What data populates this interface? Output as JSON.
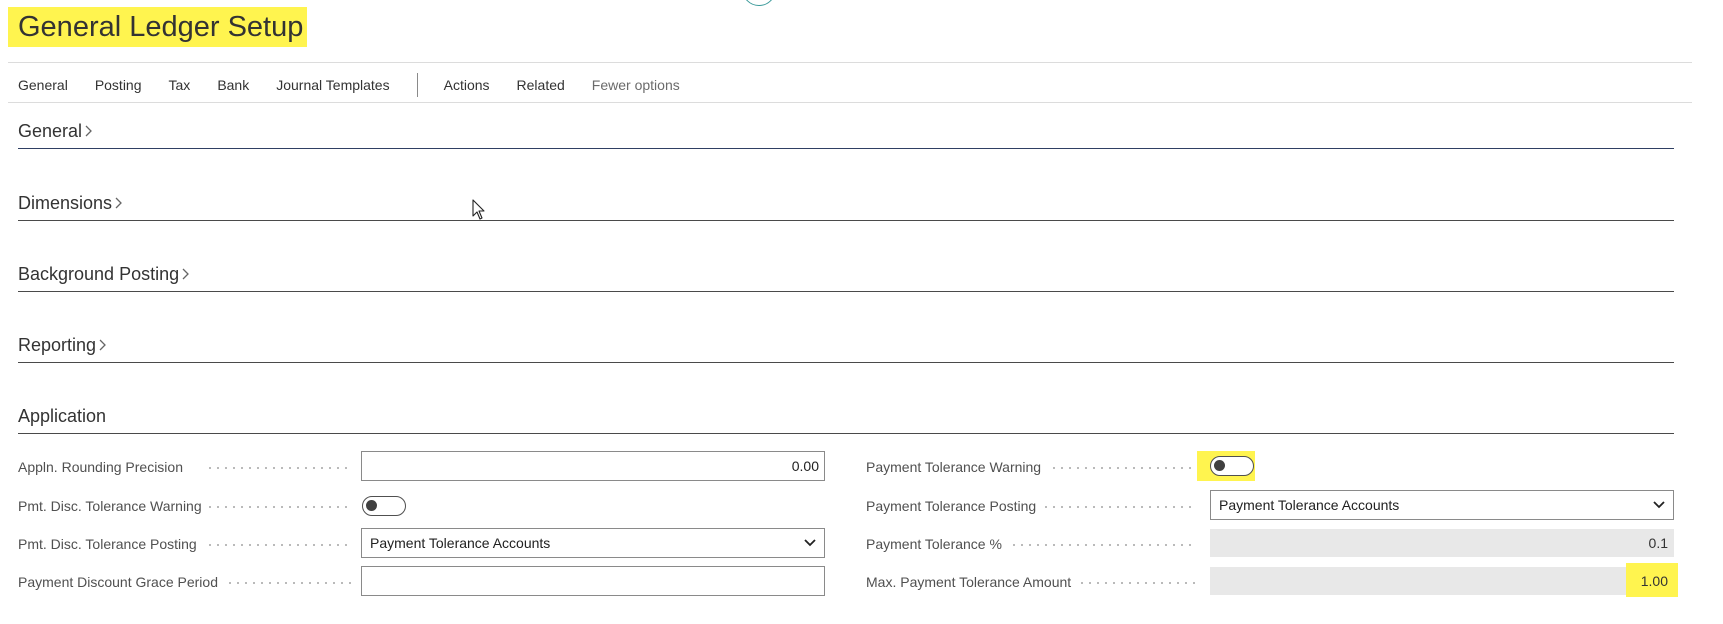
{
  "page": {
    "title": "General Ledger Setup"
  },
  "actionbar": {
    "items": [
      "General",
      "Posting",
      "Tax",
      "Bank",
      "Journal Templates"
    ],
    "secondary": [
      "Actions",
      "Related"
    ],
    "fewer_options": "Fewer options"
  },
  "sections": {
    "general": "General",
    "dimensions": "Dimensions",
    "background_posting": "Background Posting",
    "reporting": "Reporting",
    "application": "Application"
  },
  "application": {
    "left": {
      "appln_rounding_precision": {
        "label": "Appln. Rounding Precision",
        "value": "0.00"
      },
      "pmt_disc_tolerance_warning": {
        "label": "Pmt. Disc. Tolerance Warning",
        "value": false
      },
      "pmt_disc_tolerance_posting": {
        "label": "Pmt. Disc. Tolerance Posting",
        "value": "Payment Tolerance Accounts"
      },
      "payment_discount_grace_period": {
        "label": "Payment Discount Grace Period",
        "value": ""
      }
    },
    "right": {
      "payment_tolerance_warning": {
        "label": "Payment Tolerance Warning",
        "value": false
      },
      "payment_tolerance_posting": {
        "label": "Payment Tolerance Posting",
        "value": "Payment Tolerance Accounts"
      },
      "payment_tolerance_pct": {
        "label": "Payment Tolerance %",
        "value": "0.1"
      },
      "max_payment_tolerance_amount": {
        "label": "Max. Payment Tolerance Amount",
        "value": "1.00"
      }
    }
  },
  "colors": {
    "highlight": "#fff44f",
    "section_rule_active": "#2f3f63",
    "readonly_bg": "#e8e8e8"
  },
  "icons": {
    "chevron": "chevron-right-icon",
    "dropdown": "chevron-down-icon",
    "pointer": "mouse-cursor-icon"
  }
}
